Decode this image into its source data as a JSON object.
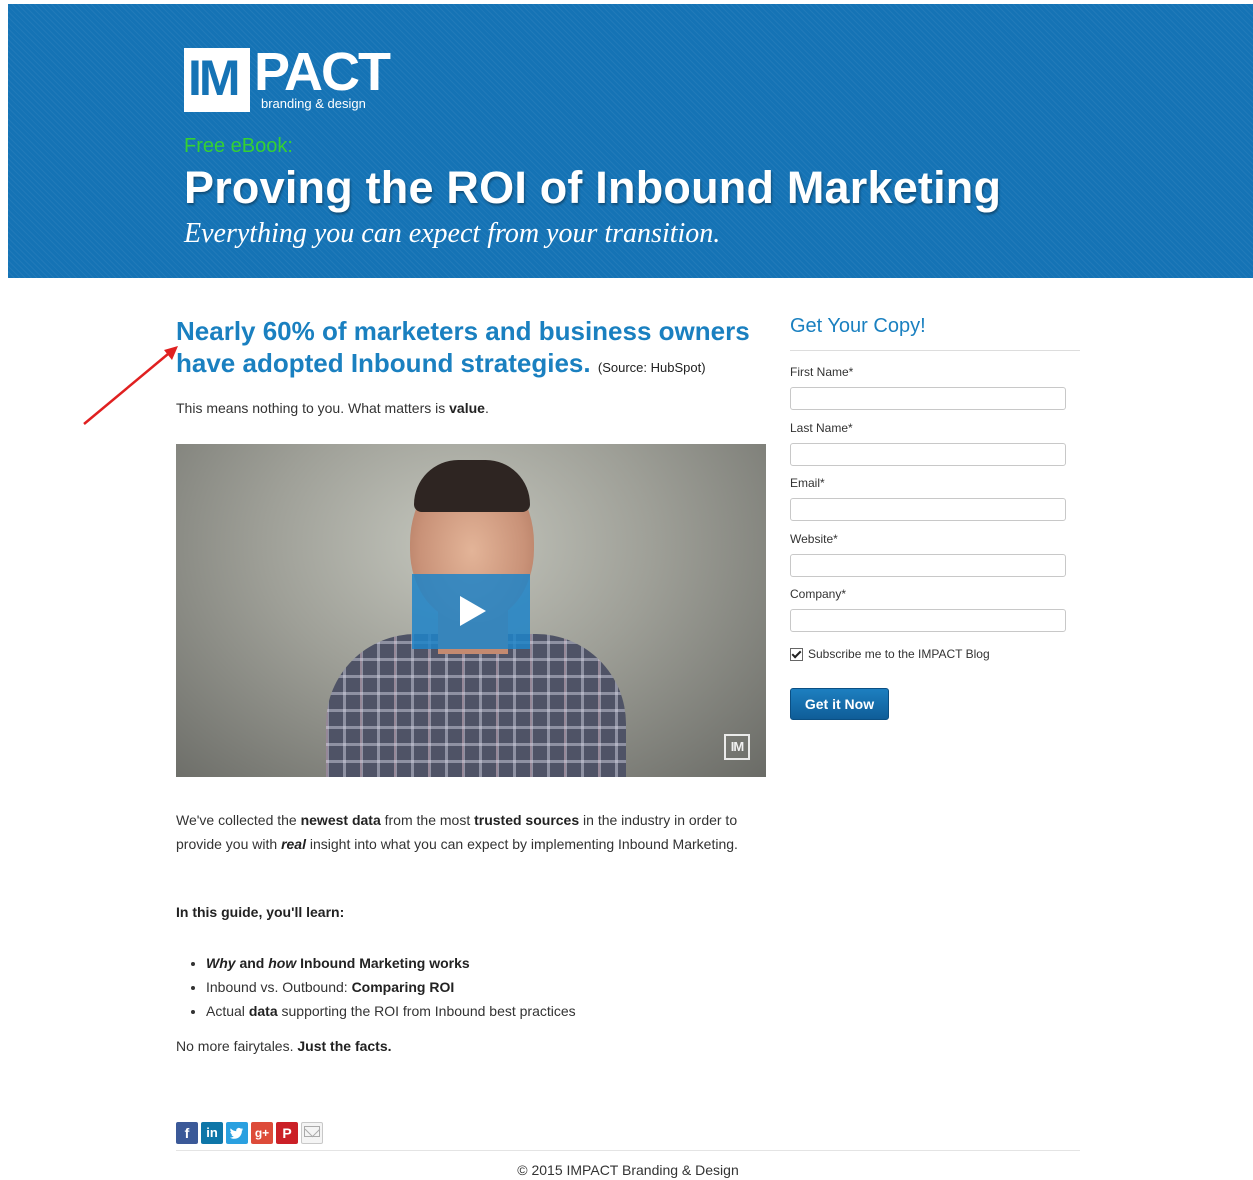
{
  "header": {
    "logo_mark": "IM",
    "logo_word": "PACT",
    "logo_tagline": "branding & design",
    "kicker": "Free eBook:",
    "title": "Proving the ROI of Inbound Marketing",
    "subtitle": "Everything you can expect from your transition.",
    "background_color": "#1573b5",
    "kicker_color": "#34d133"
  },
  "main": {
    "headline_line1": "Nearly 60% of marketers and business owners",
    "headline_line2": "have adopted Inbound strategies.",
    "headline_source": "(Source: HubSpot)",
    "intro_text": "This means nothing to you. What matters is",
    "intro_bold": "value",
    "video": {
      "play_icon": "play-icon",
      "watermark": "IM"
    },
    "paragraph": {
      "p1": "We've collected the ",
      "b1": "newest data",
      "p2": " from the most ",
      "b2": "trusted sources",
      "p3": " in the industry in order to provide you with ",
      "i1": "real",
      "p4": " insight into what you can expect by implementing Inbound Marketing."
    },
    "guide_heading": "In this guide, you'll learn:",
    "bullets": [
      {
        "i1": "Why",
        "t1": " and ",
        "i2": "how",
        "t2": " Inbound Marketing works"
      },
      {
        "t1": "Inbound vs. Outbound: ",
        "b1": "Comparing ROI"
      },
      {
        "t1": "Actual ",
        "b1": "data",
        "t2": " supporting the ROI from Inbound best practices"
      }
    ],
    "closing_text": "No more fairytales.",
    "closing_bold": "Just the facts."
  },
  "form": {
    "title": "Get Your Copy!",
    "fields": [
      {
        "label": "First Name*",
        "value": ""
      },
      {
        "label": "Last Name*",
        "value": ""
      },
      {
        "label": "Email*",
        "value": ""
      },
      {
        "label": "Website*",
        "value": ""
      },
      {
        "label": "Company*",
        "value": ""
      }
    ],
    "subscribe_label": "Subscribe me to the IMPACT Blog",
    "subscribe_checked": true,
    "submit_label": "Get it Now",
    "accent_color": "#1a80c0"
  },
  "social": {
    "icons": [
      "facebook-icon",
      "linkedin-icon",
      "twitter-icon",
      "google-plus-icon",
      "pinterest-icon",
      "email-icon"
    ],
    "facebook": "f",
    "linkedin": "in",
    "google": "g+",
    "pinterest": "P"
  },
  "footer": {
    "copyright": "© 2015 IMPACT Branding & Design"
  }
}
